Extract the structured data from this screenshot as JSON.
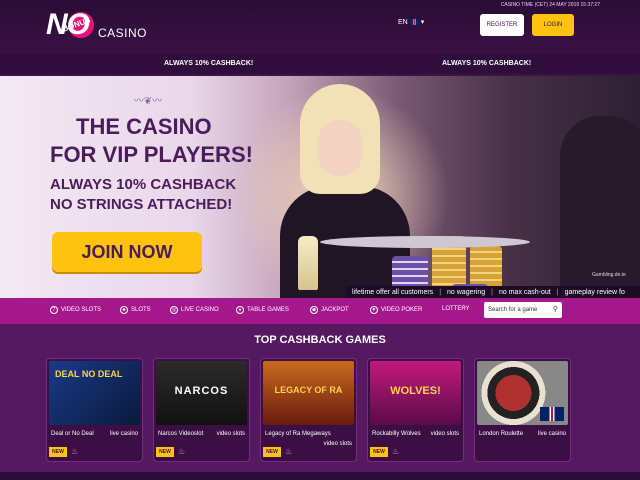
{
  "header": {
    "logo_letters": "NO",
    "logo_badge": "BONUS",
    "logo_word": "CASINO",
    "casino_time": "CASINO TIME (CET) 24 MAY 2019 15:37:27",
    "lang": "EN",
    "register_label": "REGISTER",
    "login_label": "LOGIN"
  },
  "strip": {
    "left": "ALWAYS 10% CASHBACK!",
    "right": "ALWAYS 10% CASHBACK!"
  },
  "hero": {
    "title_line1": "THE CASINO",
    "title_line2": "FOR VIP PLAYERS!",
    "sub_line1": "ALWAYS 10% CASHBACK",
    "sub_line2": "NO STRINGS ATTACHED!",
    "cta": "JOIN NOW",
    "watermark": "Gambling.de.te"
  },
  "ticker": [
    "lifetime offer all customers",
    "no wagering",
    "no max cash-out",
    "gameplay review fo"
  ],
  "nav": {
    "items": [
      "VIDEO SLOTS",
      "SLOTS",
      "LIVE CASINO",
      "TABLE GAMES",
      "JACKPOT",
      "VIDEO POKER",
      "LOTTERY"
    ],
    "search_placeholder": "Search for a game"
  },
  "section": {
    "title": "TOP CASHBACK GAMES",
    "cards": [
      {
        "name": "Deal or No Deal",
        "type": "live casino",
        "thumb": "DEAL NO DEAL",
        "new": "NEW"
      },
      {
        "name": "Narcos Videoslot",
        "type": "video slots",
        "thumb": "NARCOS",
        "new": "NEW"
      },
      {
        "name": "Legacy of Ra Megaways",
        "type": "video slots",
        "thumb": "LEGACY OF RA",
        "new": "NEW"
      },
      {
        "name": "Rockabilly Wolves",
        "type": "video slots",
        "thumb": "WOLVES!",
        "new": "NEW"
      },
      {
        "name": "London Roulette",
        "type": "live casino",
        "thumb": "",
        "new": ""
      }
    ]
  },
  "colors": {
    "accent_yellow": "#ffc20e",
    "nav_magenta": "#a4188c",
    "bg_purple": "#3d1248"
  }
}
